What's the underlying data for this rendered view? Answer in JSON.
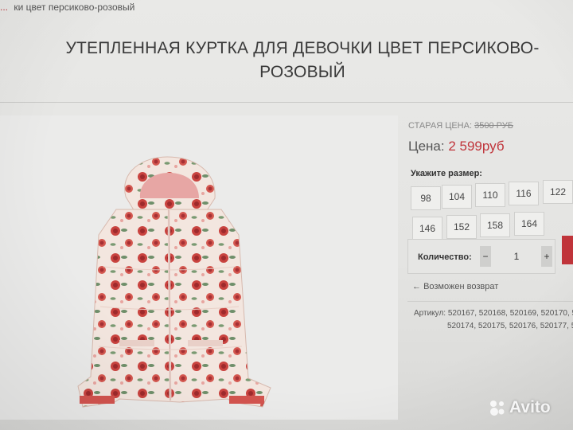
{
  "breadcrumb": {
    "link_text": "...",
    "current": "ки цвет персиково-розовый"
  },
  "product": {
    "title": "УТЕПЛЕННАЯ КУРТКА ДЛЯ ДЕВОЧКИ ЦВЕТ ПЕРСИКОВО-РОЗОВЫЙ",
    "image_alt": "jacket-product-photo"
  },
  "pricing": {
    "old_label": "СТАРАЯ ЦЕНА:",
    "old_value": "3500 РУБ",
    "price_label": "Цена:",
    "price_value": "2 599руб"
  },
  "sizes": {
    "label": "Укажите размер:",
    "options": [
      "98",
      "104",
      "110",
      "116",
      "122",
      "146",
      "152",
      "158",
      "164"
    ]
  },
  "quantity": {
    "label": "Количество:",
    "minus": "−",
    "value": "1",
    "plus": "+"
  },
  "returns": {
    "icon": "arrow-left-icon",
    "text": "Возможен возврат"
  },
  "article": {
    "label": "Артикул:",
    "line1": "520167, 520168, 520169, 520170, 5",
    "line2": "520174, 520175, 520176, 520177, 5"
  },
  "watermark": {
    "text": "Avito"
  },
  "colors": {
    "accent": "#c0343a",
    "background": "#e7e7e5"
  }
}
